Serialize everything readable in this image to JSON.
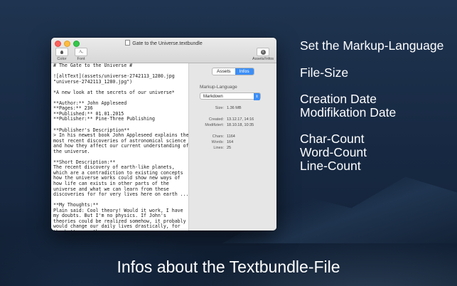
{
  "window": {
    "title": "Gate to the Universe.textbundle",
    "toolbar": {
      "color_label": "Color",
      "font_label": "Font",
      "font_glyph": "Aₓ",
      "info_glyph": "i",
      "assets_infos_label": "Assets/Infos"
    }
  },
  "editor": {
    "text": "# The Gate to the Universe #\n\n![altText](assets/universe-2742113_1280.jpg\n\"universe-2742113_1280.jpg\")\n\n*A new look at the secrets of our universe*\n\n**Author:** John Appleseed\n**Pages:** 236\n**Published:** 01.01.2015\n**Publisher:** Pine-Three Publishing\n\n**Publisher's Description**\n> In his newest book John Appleseed explains the\nmost recent discoveries of astronomical science\nand how they affect our current understanding of\nthe universe.\n\n**Short Description:**\nThe recent discovery of earth-like planets,\nwhich are a contradiction to existing concepts\nhow the universe works could show new ways of\nhow life can exists in other parts of the\nuniverse and what we can learn from these\ndiscoveries for for very lives here on earth ...\n\n**My Thoughts:**\nPlain said: Cool theory! Would it work, I have\nmy doubts. But I'm no physics. If John's\ntheories could be realized somehow, it probably\nwould change our daily lives drastically, for\nthe better or the worse."
  },
  "inspector": {
    "tabs": [
      {
        "label": "Assets",
        "active": false
      },
      {
        "label": "Infos",
        "active": true
      }
    ],
    "markup_heading": "Markup-Language",
    "markup_value": "Markdown",
    "size_label": "Size:",
    "size_value": "1.36 MB",
    "created_label": "Created:",
    "created_value": "13.12.17, 14:16",
    "modified_label": "Modifiziert:",
    "modified_value": "18.10.18, 10:35",
    "chars_label": "Chars:",
    "chars_value": "1164",
    "words_label": "Words:",
    "words_value": "164",
    "lines_label": "Lines:",
    "lines_value": "25"
  },
  "features": {
    "markup": "Set the Markup-Language",
    "filesize": "File-Size",
    "creation": "Creation Date",
    "modification": "Modifikation Date",
    "charcount": "Char-Count",
    "wordcount": "Word-Count",
    "linecount": "Line-Count"
  },
  "caption": "Infos about the Textbundle-File",
  "colors": {
    "accent": "#3c8ef6",
    "background": "#182a44"
  }
}
